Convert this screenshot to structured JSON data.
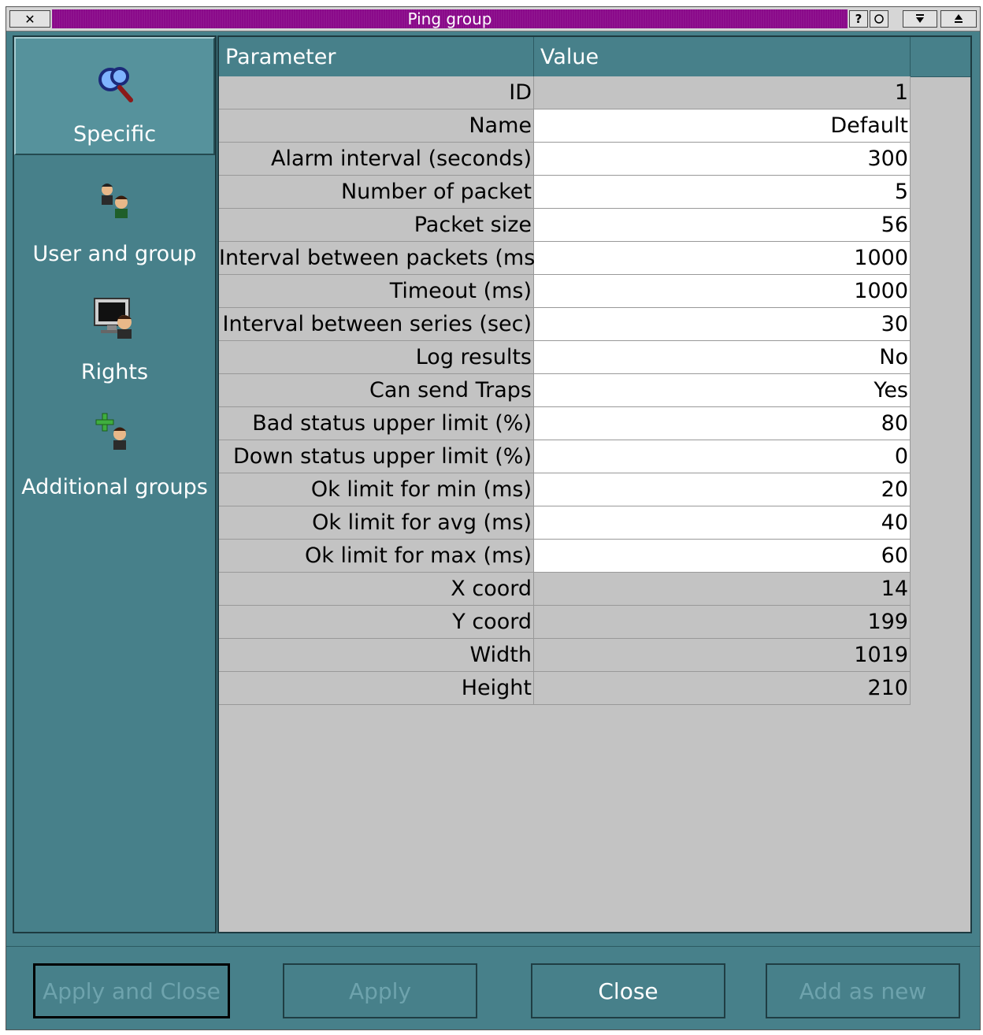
{
  "window": {
    "title": "Ping group",
    "controls": {
      "close": "✕",
      "help": "?",
      "maximize": "▾",
      "shade": "⏏"
    }
  },
  "sidebar": {
    "items": [
      {
        "label": "Specific",
        "icon": "magnifier-icon",
        "active": true
      },
      {
        "label": "User and group",
        "icon": "users-icon",
        "active": false
      },
      {
        "label": "Rights",
        "icon": "monitor-user-icon",
        "active": false
      },
      {
        "label": "Additional groups",
        "icon": "add-user-icon",
        "active": false
      }
    ]
  },
  "table": {
    "headers": {
      "parameter": "Parameter",
      "value": "Value"
    },
    "rows": [
      {
        "parameter": "ID",
        "value": "1",
        "editable": false
      },
      {
        "parameter": "Name",
        "value": "Default",
        "editable": true
      },
      {
        "parameter": "Alarm interval (seconds)",
        "value": "300",
        "editable": true
      },
      {
        "parameter": "Number of packet",
        "value": "5",
        "editable": true
      },
      {
        "parameter": "Packet size",
        "value": "56",
        "editable": true
      },
      {
        "parameter": "Interval between packets (ms)",
        "value": "1000",
        "editable": true
      },
      {
        "parameter": "Timeout (ms)",
        "value": "1000",
        "editable": true
      },
      {
        "parameter": "Interval between series (sec)",
        "value": "30",
        "editable": true
      },
      {
        "parameter": "Log results",
        "value": "No",
        "editable": true
      },
      {
        "parameter": "Can send Traps",
        "value": "Yes",
        "editable": true
      },
      {
        "parameter": "Bad status upper limit (%)",
        "value": "80",
        "editable": true
      },
      {
        "parameter": "Down status upper limit (%)",
        "value": "0",
        "editable": true
      },
      {
        "parameter": "Ok limit for min (ms)",
        "value": "20",
        "editable": true
      },
      {
        "parameter": "Ok limit for avg (ms)",
        "value": "40",
        "editable": true
      },
      {
        "parameter": "Ok limit for max (ms)",
        "value": "60",
        "editable": true
      },
      {
        "parameter": "X coord",
        "value": "14",
        "editable": false
      },
      {
        "parameter": "Y coord",
        "value": "199",
        "editable": false
      },
      {
        "parameter": "Width",
        "value": "1019",
        "editable": false
      },
      {
        "parameter": "Height",
        "value": "210",
        "editable": false
      }
    ]
  },
  "buttons": {
    "apply_and_close": "Apply and Close",
    "apply": "Apply",
    "close": "Close",
    "add_as_new": "Add as new"
  },
  "colors": {
    "teal": "#47808a",
    "title_purple": "#8a0a8a",
    "grid_gray": "#c3c3c3",
    "disabled_text": "#6ea3ad"
  }
}
